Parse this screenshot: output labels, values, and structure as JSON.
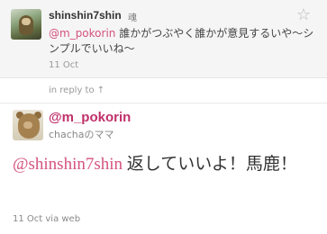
{
  "in_reply_tweet": {
    "screen_name": "shinshin7shin",
    "badge": "魂",
    "mention": "@m_pokorin",
    "text": " 誰かがつぶやく誰かが意見するいや～シンプルでいいね～",
    "date": "11 Oct",
    "star_icon": "star-icon"
  },
  "in_reply_to_label": "in reply to ↑",
  "main_tweet": {
    "screen_name": "@m_pokorin",
    "display_name": "chachaのママ",
    "mention": "@shinshin7shin",
    "text": " 返していいよ！馬鹿！",
    "meta": "11 Oct via web"
  },
  "colors": {
    "mention": "#d4537d",
    "handle": "#c0306a",
    "reply_background": "#f5f5f5"
  }
}
